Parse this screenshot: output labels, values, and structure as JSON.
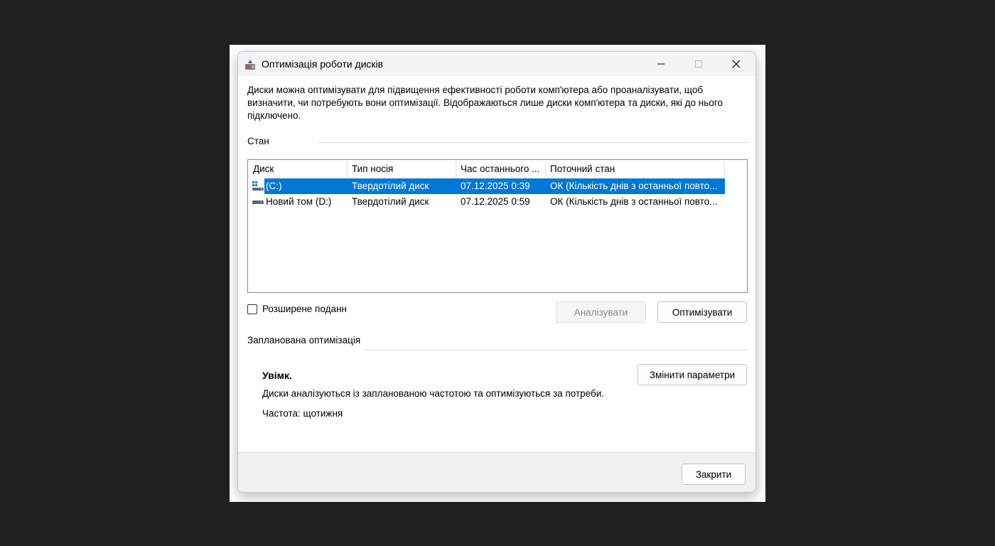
{
  "window": {
    "title": "Оптимізація роботи дисків",
    "description": "Диски можна оптимізувати для підвищення ефективності роботи комп'ютера або проаналізувати, щоб визначити, чи потребують вони оптимізації. Відображаються лише диски комп'ютера та диски, які до нього підключено."
  },
  "status": {
    "section_label": "Стан",
    "columns": [
      "Диск",
      "Тип носія",
      "Час останнього ...",
      "Поточний стан"
    ],
    "drives": [
      {
        "name": "(C:)",
        "media": "Твердотілий диск",
        "last_run": "07.12.2025 0:39",
        "state": "ОК (Кількість днів з останньої повто...",
        "icon": "system-drive-icon",
        "selected": true
      },
      {
        "name": "Новий том (D:)",
        "media": "Твердотілий диск",
        "last_run": "07.12.2025 0:59",
        "state": "ОК (Кількість днів з останньої повто...",
        "icon": "drive-icon",
        "selected": false
      }
    ],
    "advanced_view_label": "Розширене поданн",
    "analyze_label": "Аналізувати",
    "optimize_label": "Оптимізувати"
  },
  "schedule": {
    "section_label": "Запланована оптимізація",
    "state": "Увімк.",
    "description": "Диски аналізуються із запланованою частотою та оптимізуються за потреби.",
    "frequency": "Частота: щотижня",
    "change_settings_label": "Змінити параметри"
  },
  "footer": {
    "close_label": "Закрити"
  },
  "colors": {
    "selection": "#0078d7",
    "backdrop": "#202020"
  }
}
